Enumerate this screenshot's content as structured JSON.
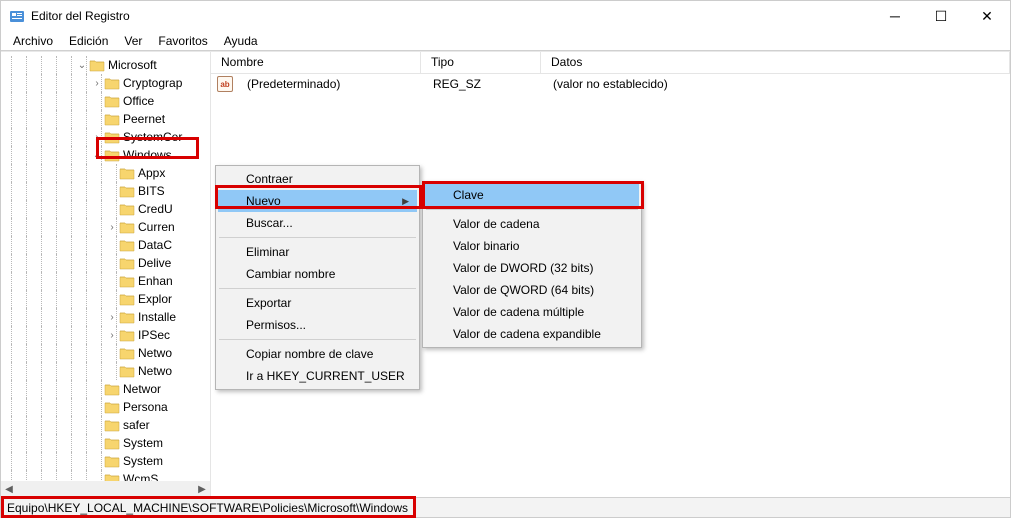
{
  "window": {
    "title": "Editor del Registro"
  },
  "menu": {
    "file": "Archivo",
    "edit": "Edición",
    "view": "Ver",
    "favorites": "Favoritos",
    "help": "Ayuda"
  },
  "tree": {
    "microsoft": "Microsoft",
    "items": [
      "Cryptograp",
      "Office",
      "Peernet",
      "SystemCer",
      "Windows",
      "Appx",
      "BITS",
      "CredU",
      "Curren",
      "DataC",
      "Delive",
      "Enhan",
      "Explor",
      "Installe",
      "IPSec",
      "Netwo",
      "Netwo",
      "Networ",
      "Persona",
      "safer",
      "System",
      "System",
      "WcmS"
    ]
  },
  "list": {
    "col_name": "Nombre",
    "col_type": "Tipo",
    "col_data": "Datos",
    "row_name": "(Predeterminado)",
    "row_type": "REG_SZ",
    "row_data": "(valor no establecido)"
  },
  "ctx1": {
    "collapse": "Contraer",
    "new": "Nuevo",
    "find": "Buscar...",
    "delete": "Eliminar",
    "rename": "Cambiar nombre",
    "export": "Exportar",
    "permissions": "Permisos...",
    "copy_key": "Copiar nombre de clave",
    "goto_hkcu": "Ir a HKEY_CURRENT_USER"
  },
  "ctx2": {
    "key": "Clave",
    "string": "Valor de cadena",
    "binary": "Valor binario",
    "dword": "Valor de DWORD (32 bits)",
    "qword": "Valor de QWORD (64 bits)",
    "multi": "Valor de cadena múltiple",
    "expand": "Valor de cadena expandible"
  },
  "status": {
    "path": "Equipo\\HKEY_LOCAL_MACHINE\\SOFTWARE\\Policies\\Microsoft\\Windows"
  }
}
